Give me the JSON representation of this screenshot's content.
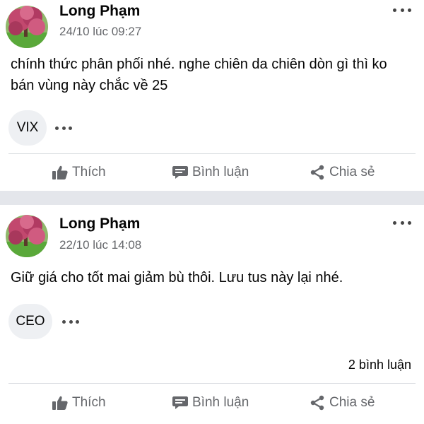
{
  "posts": [
    {
      "author": "Long Phạm",
      "timestamp": "24/10 lúc 09:27",
      "text": "chính thức phân phối nhé. nghe chiên da chiên dòn gì thì ko bán vùng này chắc về 25",
      "tag": "VIX",
      "comments_count": "",
      "actions": {
        "like": "Thích",
        "comment": "Bình luận",
        "share": "Chia sẻ"
      }
    },
    {
      "author": "Long Phạm",
      "timestamp": "22/10 lúc 14:08",
      "text": "Giữ giá cho tốt mai giảm bù thôi. Lưu tus này lại nhé.",
      "tag": "CEO",
      "comments_count": "2 bình luận",
      "actions": {
        "like": "Thích",
        "comment": "Bình luận",
        "share": "Chia sẻ"
      }
    }
  ],
  "colors": {
    "separator": "#e4e6eb",
    "secondary_text": "#65676b",
    "tag_background": "#eef0f3"
  },
  "icons": [
    "avatar-blossom",
    "more-dots-icon",
    "like-thumb-icon",
    "comment-bubble-icon",
    "share-icon"
  ]
}
